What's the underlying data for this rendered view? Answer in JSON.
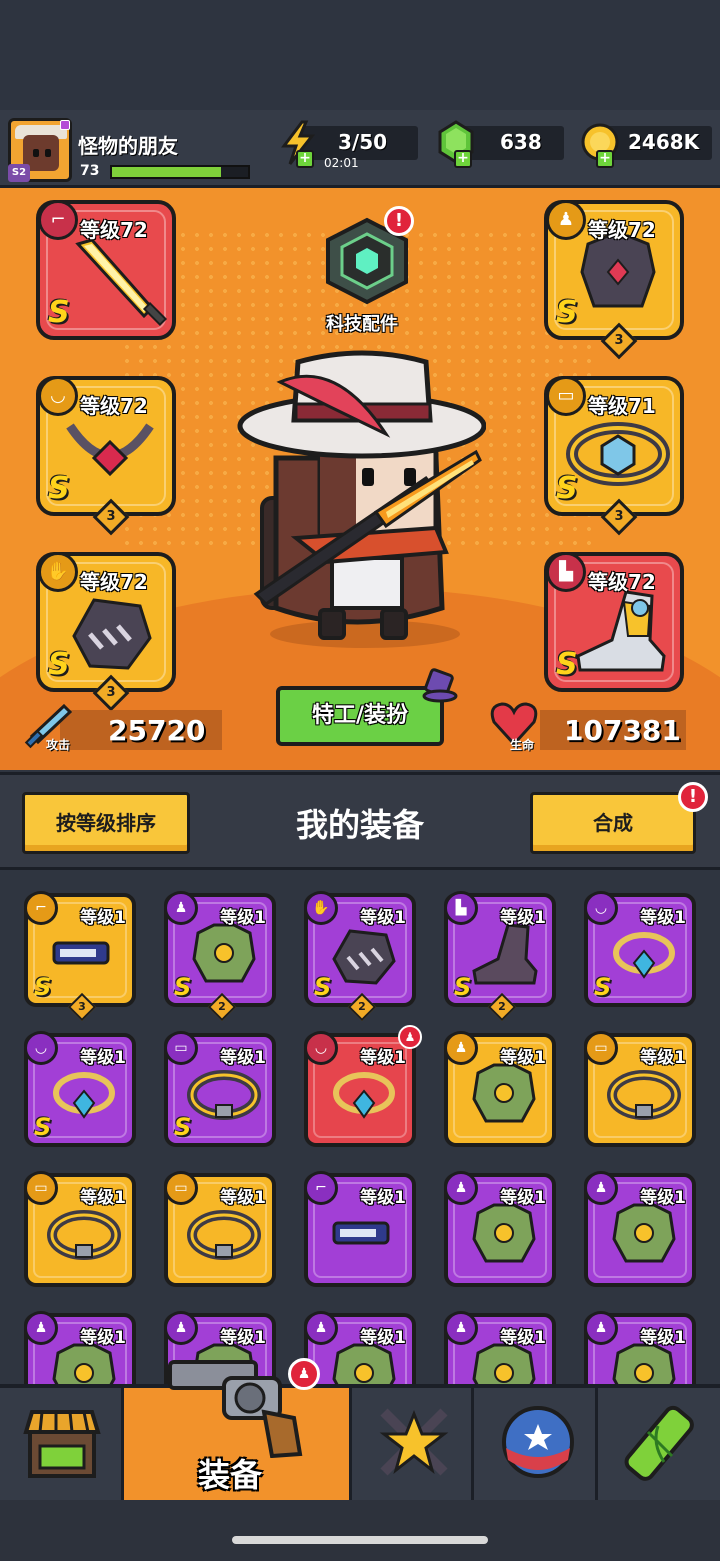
{
  "player": {
    "name": "怪物的朋友",
    "level": "73",
    "season": "S2",
    "xp_fraction": 0.8
  },
  "resources": {
    "energy": "3/50",
    "energy_timer": "02:01",
    "gems": "638",
    "coins": "2468K"
  },
  "equipped": {
    "weapon": {
      "level": "等级72",
      "grade": "S"
    },
    "armor": {
      "level": "等级72",
      "grade": "S",
      "stars": "3"
    },
    "necklace": {
      "level": "等级72",
      "grade": "S",
      "stars": "3"
    },
    "belt": {
      "level": "等级71",
      "grade": "S",
      "stars": "3"
    },
    "gloves": {
      "level": "等级72",
      "grade": "S",
      "stars": "3"
    },
    "boots": {
      "level": "等级72",
      "grade": "S"
    }
  },
  "tech": {
    "label": "科技配件",
    "alert": "!"
  },
  "agent_button": "特工/装扮",
  "stats": {
    "attack_label": "攻击",
    "attack_value": "25720",
    "hp_label": "生命",
    "hp_value": "107381"
  },
  "section": {
    "sort_button": "按等级排序",
    "title": "我的装备",
    "merge_button": "合成",
    "merge_alert": "!"
  },
  "inventory": [
    {
      "level": "等级1",
      "grade": "S",
      "stars": "3",
      "color": "gold",
      "type": "weapon"
    },
    {
      "level": "等级1",
      "grade": "S",
      "stars": "2",
      "color": "purple",
      "type": "armor"
    },
    {
      "level": "等级1",
      "grade": "S",
      "stars": "2",
      "color": "purple",
      "type": "gloves"
    },
    {
      "level": "等级1",
      "grade": "S",
      "stars": "2",
      "color": "purple",
      "type": "boots"
    },
    {
      "level": "等级1",
      "grade": "S",
      "stars": "",
      "color": "purple",
      "type": "necklace"
    },
    {
      "level": "等级1",
      "grade": "S",
      "stars": "",
      "color": "purple",
      "type": "necklace"
    },
    {
      "level": "等级1",
      "grade": "S",
      "stars": "",
      "color": "purple",
      "type": "belt"
    },
    {
      "level": "等级1",
      "grade": "",
      "stars": "",
      "color": "red",
      "type": "necklace"
    },
    {
      "level": "等级1",
      "grade": "",
      "stars": "",
      "color": "gold",
      "type": "armor"
    },
    {
      "level": "等级1",
      "grade": "",
      "stars": "",
      "color": "gold",
      "type": "belt"
    },
    {
      "level": "等级1",
      "grade": "",
      "stars": "",
      "color": "gold",
      "type": "belt"
    },
    {
      "level": "等级1",
      "grade": "",
      "stars": "",
      "color": "gold",
      "type": "belt"
    },
    {
      "level": "等级1",
      "grade": "",
      "stars": "",
      "color": "purple",
      "type": "weapon"
    },
    {
      "level": "等级1",
      "grade": "",
      "stars": "",
      "color": "purple",
      "type": "armor"
    },
    {
      "level": "等级1",
      "grade": "",
      "stars": "",
      "color": "purple",
      "type": "armor"
    },
    {
      "level": "等级1",
      "grade": "",
      "stars": "",
      "color": "purple",
      "type": "armor"
    },
    {
      "level": "等级1",
      "grade": "",
      "stars": "",
      "color": "purple",
      "type": "armor"
    },
    {
      "level": "等级1",
      "grade": "",
      "stars": "",
      "color": "purple",
      "type": "armor"
    },
    {
      "level": "等级1",
      "grade": "",
      "stars": "",
      "color": "purple",
      "type": "armor"
    },
    {
      "level": "等级1",
      "grade": "",
      "stars": "",
      "color": "purple",
      "type": "armor"
    }
  ],
  "nav": {
    "active_label": "装备",
    "tabs": [
      "shop-icon",
      "revolver-icon",
      "star-swords-icon",
      "star-ball-icon",
      "dna-capsule-icon"
    ]
  },
  "colors": {
    "orange_bg": "#f2922b",
    "gold_card": "#f7b727",
    "purple_card": "#a23fd6",
    "red_card": "#e6454d",
    "green_button": "#6bd045",
    "yellow_button": "#f9c63a"
  }
}
